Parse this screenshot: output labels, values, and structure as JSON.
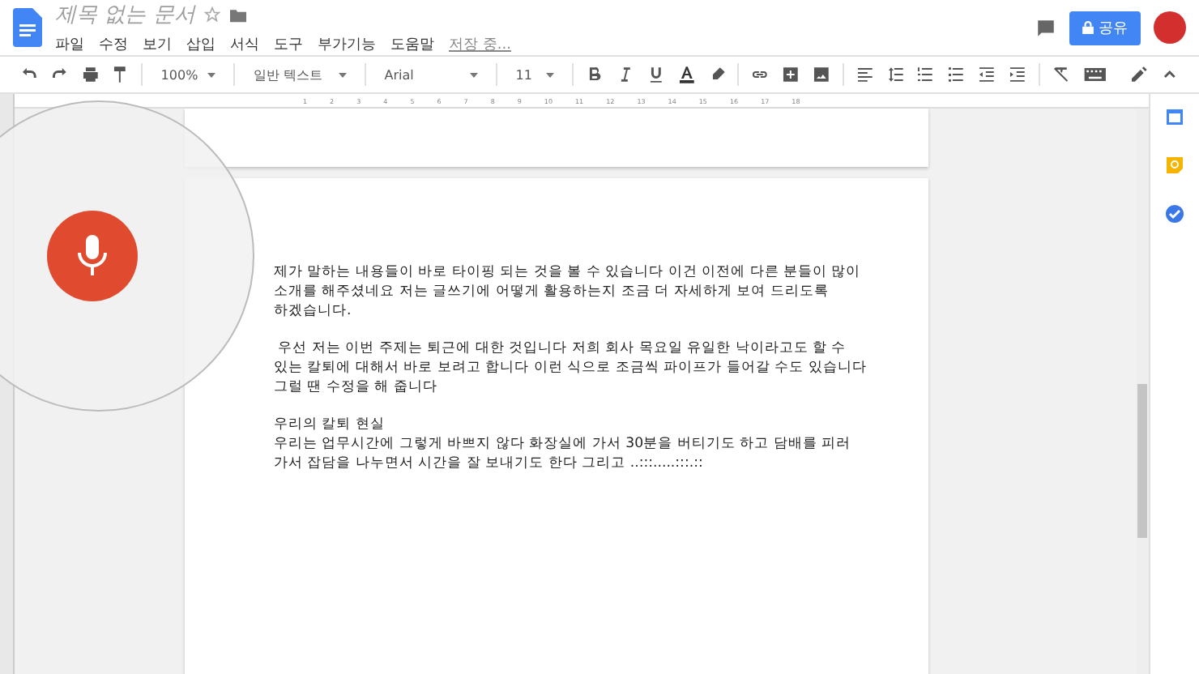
{
  "document": {
    "title": "제목 없는 문서",
    "starred": false,
    "save_status": "저장 중..."
  },
  "menu": [
    "파일",
    "수정",
    "보기",
    "삽입",
    "서식",
    "도구",
    "부가기능",
    "도움말"
  ],
  "share_button": {
    "label": "공유"
  },
  "toolbar": {
    "zoom": "100%",
    "style": "일반 텍스트",
    "font": "Arial",
    "size": "11"
  },
  "ruler_marks": [
    "1",
    "2",
    "3",
    "4",
    "5",
    "6",
    "7",
    "8",
    "9",
    "10",
    "11",
    "12",
    "13",
    "14",
    "15",
    "16",
    "17",
    "18"
  ],
  "paragraphs": [
    {
      "lines": [
        "제가 말하는 내용들이 바로 타이핑 되는 것을 볼 수 있습니다 이건 이전에 다른 분들이 많이",
        "소개를 해주셨네요 저는 글쓰기에 어떻게 활용하는지 조금 더 자세하게 보여 드리도록",
        "하겠습니다."
      ]
    },
    {
      "lines": [
        " 우선 저는 이번 주제는 퇴근에 대한 것입니다 저희 회사 목요일 유일한 낙이라고도 할 수",
        "있는 칼퇴에 대해서 바로 보려고 합니다 이런 식으로 조금씩 파이프가 들어갈 수도 있습니다",
        "그럴 땐 수정을 해 줍니다"
      ]
    },
    {
      "lines": [
        "우리의 칼퇴 현실",
        "우리는 업무시간에 그렇게 바쁘지 않다 화장실에 가서 30분을 버티기도 하고 담배를 피러",
        "가서 잡담을 나누면서 시간을 잘 보내기도 한다 그리고 ..:::.....:::.::"
      ]
    }
  ],
  "voice_typing": {
    "listening": true
  }
}
